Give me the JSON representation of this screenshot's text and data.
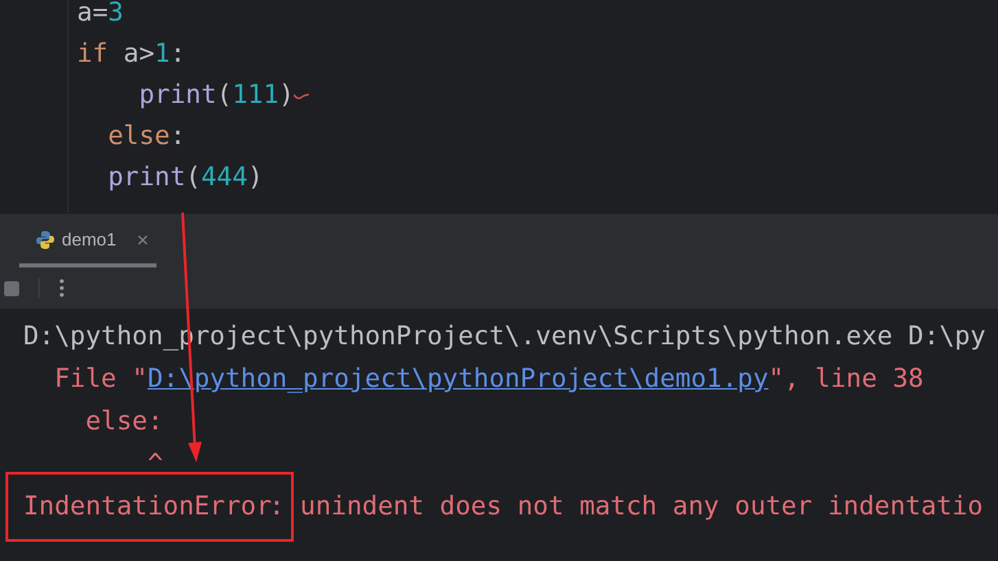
{
  "editor": {
    "lines": [
      [
        {
          "kind": "name",
          "text": "a"
        },
        {
          "kind": "op",
          "text": "="
        },
        {
          "kind": "number",
          "text": "3"
        }
      ],
      [
        {
          "kind": "keyword",
          "text": "if"
        },
        {
          "kind": "name",
          "text": " a>"
        },
        {
          "kind": "number",
          "text": "1"
        },
        {
          "kind": "op",
          "text": ":"
        }
      ],
      [
        {
          "kind": "call",
          "text": "    print"
        },
        {
          "kind": "op",
          "text": "("
        },
        {
          "kind": "number",
          "text": "111"
        },
        {
          "kind": "op",
          "text": ")"
        },
        {
          "kind": "squiggle"
        }
      ],
      [
        {
          "kind": "keyword",
          "text": "  else"
        },
        {
          "kind": "op",
          "text": ":"
        }
      ],
      [
        {
          "kind": "call",
          "text": "  print"
        },
        {
          "kind": "op",
          "text": "("
        },
        {
          "kind": "number",
          "text": "444"
        },
        {
          "kind": "op",
          "text": ")"
        }
      ]
    ]
  },
  "run_panel": {
    "tabs": [
      {
        "label": "demo1",
        "selected": true
      }
    ],
    "output": [
      {
        "kind": "plain",
        "text": "D:\\python_project\\pythonProject\\.venv\\Scripts\\python.exe D:\\py"
      },
      {
        "kind": "file",
        "prefix": "  File \"",
        "link": "D:\\python_project\\pythonProject\\demo1.py",
        "suffix": "\", line 38"
      },
      {
        "kind": "error",
        "text": "    else:"
      },
      {
        "kind": "error",
        "text": "        ^"
      },
      {
        "kind": "highlighted",
        "highlight": "IndentationError",
        "text": ": unindent does not match any outer indentatio"
      }
    ]
  }
}
